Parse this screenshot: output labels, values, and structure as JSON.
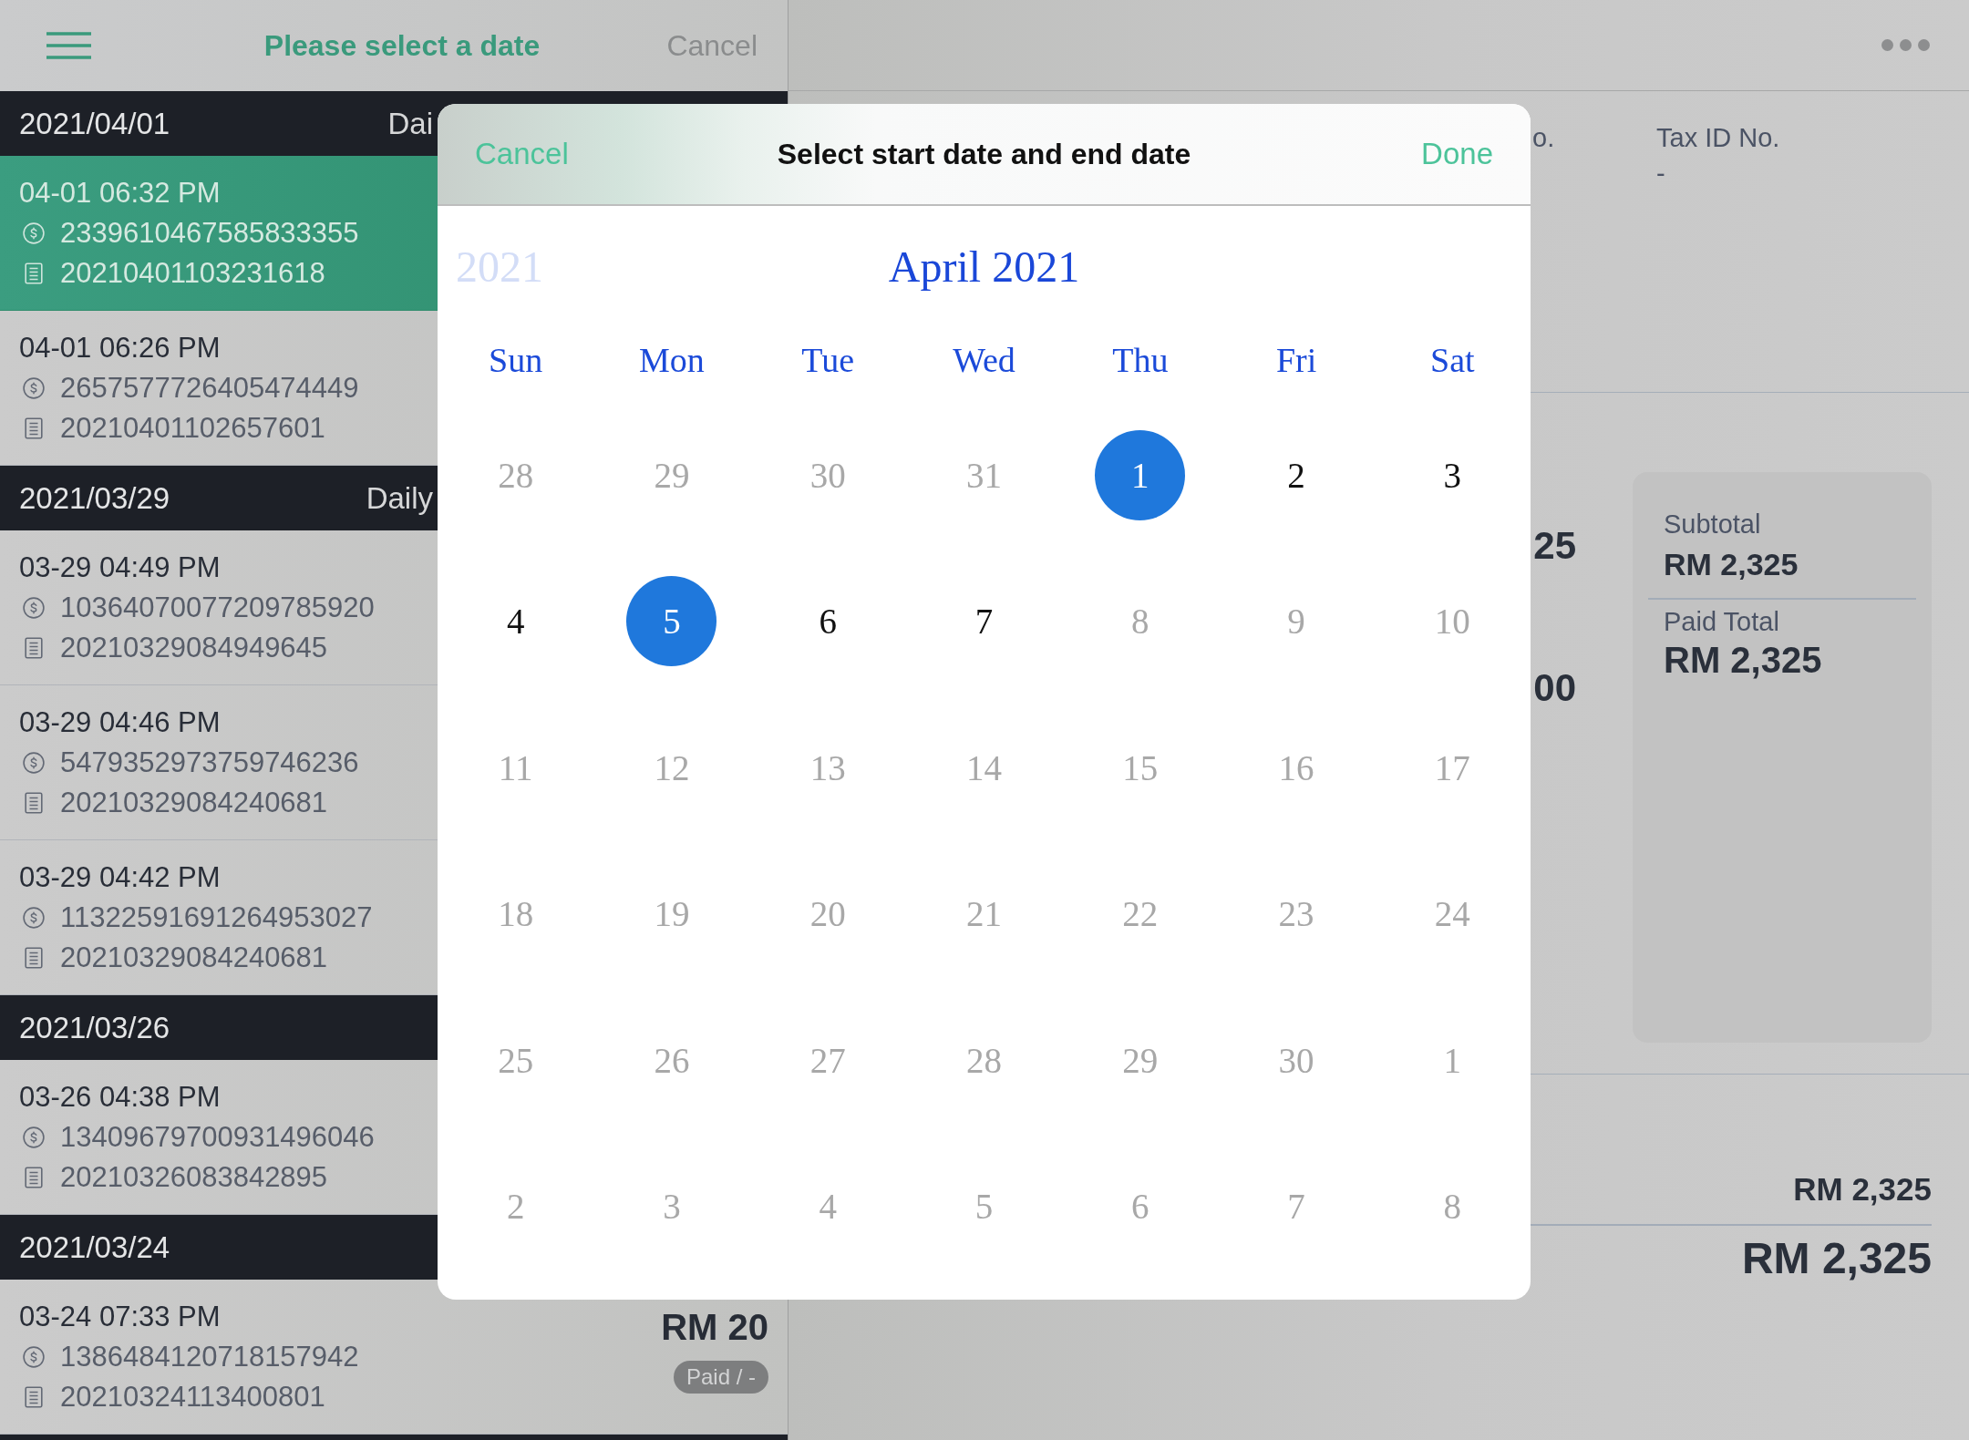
{
  "header": {
    "title": "Please select a date",
    "cancel": "Cancel"
  },
  "transactions": [
    {
      "date": "2021/04/01",
      "label": "Dai",
      "items": [
        {
          "time": "04-01 06:32 PM",
          "payment_id": "2339610467585833355",
          "order_no": "20210401103231618",
          "selected": true
        },
        {
          "time": "04-01 06:26 PM",
          "payment_id": "2657577726405474449",
          "order_no": "20210401102657601",
          "selected": false
        }
      ]
    },
    {
      "date": "2021/03/29",
      "label": "Daily",
      "items": [
        {
          "time": "03-29 04:49 PM",
          "payment_id": "10364070077209785920",
          "order_no": "20210329084949645",
          "selected": false
        },
        {
          "time": "03-29 04:46 PM",
          "payment_id": "5479352973759746236",
          "order_no": "20210329084240681",
          "selected": false
        },
        {
          "time": "03-29 04:42 PM",
          "payment_id": "11322591691264953027",
          "order_no": "20210329084240681",
          "selected": false
        }
      ]
    },
    {
      "date": "2021/03/26",
      "items": [
        {
          "time": "03-26 04:38 PM",
          "payment_id": "13409679700931496046",
          "order_no": "20210326083842895",
          "selected": false
        }
      ]
    },
    {
      "date": "2021/03/24",
      "items": [
        {
          "time": "03-24 07:33 PM",
          "payment_id": "1386484120718157942",
          "order_no": "20210324113400801",
          "amount": "RM 20",
          "status": "Paid / -",
          "selected": false
        }
      ]
    }
  ],
  "detail": {
    "fields": [
      {
        "label": "o."
      },
      {
        "label": "Tax ID No.",
        "value": "-"
      }
    ],
    "amounts": [
      "25",
      "00"
    ],
    "summary": {
      "subtotal_label": "Subtotal",
      "subtotal": "RM 2,325",
      "paid_label": "Paid Total",
      "paid_total": "RM 2,325"
    },
    "totals": [
      {
        "kind": "minor",
        "amount": "RM 2,325"
      },
      {
        "kind": "grand",
        "amount": "RM 2,325"
      }
    ]
  },
  "date_picker": {
    "cancel": "Cancel",
    "title": "Select start date and end date",
    "done": "Done",
    "previous_month": "2021",
    "month": "April 2021",
    "weekdays": [
      "Sun",
      "Mon",
      "Tue",
      "Wed",
      "Thu",
      "Fri",
      "Sat"
    ],
    "weeks": [
      [
        {
          "day": "28",
          "disabled": true,
          "selected": false
        },
        {
          "day": "29",
          "disabled": true,
          "selected": false
        },
        {
          "day": "30",
          "disabled": true,
          "selected": false
        },
        {
          "day": "31",
          "disabled": true,
          "selected": false
        },
        {
          "day": "1",
          "disabled": false,
          "selected": true
        },
        {
          "day": "2",
          "disabled": false,
          "selected": false
        },
        {
          "day": "3",
          "disabled": false,
          "selected": false
        }
      ],
      [
        {
          "day": "4",
          "disabled": false,
          "selected": false
        },
        {
          "day": "5",
          "disabled": false,
          "selected": true
        },
        {
          "day": "6",
          "disabled": false,
          "selected": false
        },
        {
          "day": "7",
          "disabled": false,
          "selected": false
        },
        {
          "day": "8",
          "disabled": true,
          "selected": false
        },
        {
          "day": "9",
          "disabled": true,
          "selected": false
        },
        {
          "day": "10",
          "disabled": true,
          "selected": false
        }
      ],
      [
        {
          "day": "11",
          "disabled": true,
          "selected": false
        },
        {
          "day": "12",
          "disabled": true,
          "selected": false
        },
        {
          "day": "13",
          "disabled": true,
          "selected": false
        },
        {
          "day": "14",
          "disabled": true,
          "selected": false
        },
        {
          "day": "15",
          "disabled": true,
          "selected": false
        },
        {
          "day": "16",
          "disabled": true,
          "selected": false
        },
        {
          "day": "17",
          "disabled": true,
          "selected": false
        }
      ],
      [
        {
          "day": "18",
          "disabled": true,
          "selected": false
        },
        {
          "day": "19",
          "disabled": true,
          "selected": false
        },
        {
          "day": "20",
          "disabled": true,
          "selected": false
        },
        {
          "day": "21",
          "disabled": true,
          "selected": false
        },
        {
          "day": "22",
          "disabled": true,
          "selected": false
        },
        {
          "day": "23",
          "disabled": true,
          "selected": false
        },
        {
          "day": "24",
          "disabled": true,
          "selected": false
        }
      ],
      [
        {
          "day": "25",
          "disabled": true,
          "selected": false
        },
        {
          "day": "26",
          "disabled": true,
          "selected": false
        },
        {
          "day": "27",
          "disabled": true,
          "selected": false
        },
        {
          "day": "28",
          "disabled": true,
          "selected": false
        },
        {
          "day": "29",
          "disabled": true,
          "selected": false
        },
        {
          "day": "30",
          "disabled": true,
          "selected": false
        },
        {
          "day": "1",
          "disabled": true,
          "selected": false
        }
      ],
      [
        {
          "day": "2",
          "disabled": true,
          "selected": false
        },
        {
          "day": "3",
          "disabled": true,
          "selected": false
        },
        {
          "day": "4",
          "disabled": true,
          "selected": false
        },
        {
          "day": "5",
          "disabled": true,
          "selected": false
        },
        {
          "day": "6",
          "disabled": true,
          "selected": false
        },
        {
          "day": "7",
          "disabled": true,
          "selected": false
        },
        {
          "day": "8",
          "disabled": true,
          "selected": false
        }
      ]
    ]
  }
}
